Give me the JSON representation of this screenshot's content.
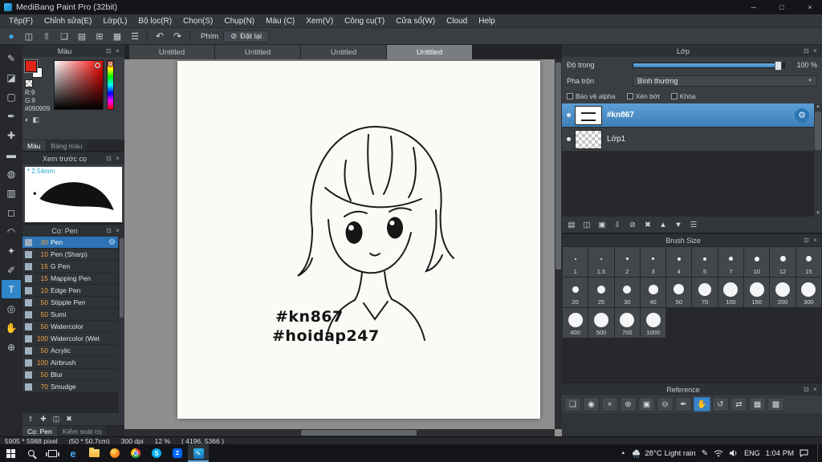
{
  "ui": {
    "popout_glyph": "⊡",
    "close_glyph": "×",
    "min_glyph": "─",
    "max_glyph": "□",
    "undo_glyph": "↶",
    "redo_glyph": "↷",
    "gear_glyph": "⚙",
    "dropdown_glyph": "▼",
    "scroll_up_glyph": "▲",
    "scroll_down_glyph": "▼"
  },
  "window": {
    "title": "MediBang Paint Pro (32bit)"
  },
  "menu_bar": {
    "items": [
      "Tệp(F)",
      "Chỉnh sửa(E)",
      "Lớp(L)",
      "Bộ lọc(R)",
      "Chọn(S)",
      "Chụp(N)",
      "Màu (C)",
      "Xem(V)",
      "Công cụ(T)",
      "Cửa sổ(W)",
      "Cloud",
      "Help"
    ]
  },
  "toolbar": {
    "icons": [
      {
        "name": "cloud-icon",
        "glyph": "●"
      },
      {
        "name": "save-icon",
        "glyph": "◫"
      },
      {
        "name": "export-icon",
        "glyph": "⇧"
      },
      {
        "name": "window-icon",
        "glyph": "❏"
      },
      {
        "name": "document-icon",
        "glyph": "▤"
      },
      {
        "name": "grid-icon",
        "glyph": "⊞"
      },
      {
        "name": "material-panel-icon",
        "glyph": "▦"
      },
      {
        "name": "list-icon",
        "glyph": "☰"
      }
    ],
    "key_label": "Phím",
    "reset_icon_glyph": "⊘",
    "reset_button": "Đặt lại"
  },
  "tools": [
    {
      "name": "brush-tool",
      "glyph": "✎"
    },
    {
      "name": "eraser-tool",
      "glyph": "◪"
    },
    {
      "name": "marquee-tool",
      "glyph": "▢"
    },
    {
      "name": "pen-tool",
      "glyph": "✒"
    },
    {
      "name": "move-tool",
      "glyph": "✚"
    },
    {
      "name": "shape-brush-tool",
      "glyph": "▬"
    },
    {
      "name": "bucket-tool",
      "glyph": "◍"
    },
    {
      "name": "gradient-tool",
      "glyph": "▥"
    },
    {
      "name": "select-tool",
      "glyph": "◻"
    },
    {
      "name": "lasso-tool",
      "glyph": "◠"
    },
    {
      "name": "magic-wand-tool",
      "glyph": "✦"
    },
    {
      "name": "select-pen-tool",
      "glyph": "✐"
    },
    {
      "name": "text-tool",
      "glyph": "T",
      "active": true
    },
    {
      "name": "eyedropper-tool",
      "glyph": "◎"
    },
    {
      "name": "pan-tool",
      "glyph": "✋"
    },
    {
      "name": "zoom-tool",
      "glyph": "⊕"
    }
  ],
  "color_panel": {
    "title": "Màu",
    "r_value": "R:9",
    "g_value": "G:9",
    "hex_value": "#090909",
    "tabs": [
      {
        "label": "Màu",
        "active": true
      },
      {
        "label": "Bảng màu",
        "active": false
      }
    ]
  },
  "preview_panel": {
    "title": "Xem trước cọ",
    "size_label": "* 2.54mm"
  },
  "brush_panel": {
    "title": "Cọ: Pen",
    "brushes": [
      {
        "size": "30",
        "name": "Pen",
        "selected": true
      },
      {
        "size": "10",
        "name": "Pen (Sharp)"
      },
      {
        "size": "15",
        "name": "G Pen"
      },
      {
        "size": "15",
        "name": "Mapping Pen"
      },
      {
        "size": "10",
        "name": "Edge Pen"
      },
      {
        "size": "50",
        "name": "Stipple Pen"
      },
      {
        "size": "50",
        "name": "Sumi"
      },
      {
        "size": "50",
        "name": "Watercolor"
      },
      {
        "size": "100",
        "name": "Watercolor (Wet"
      },
      {
        "size": "50",
        "name": "Acrylic"
      },
      {
        "size": "100",
        "name": "Airbrush"
      },
      {
        "size": "50",
        "name": "Blur"
      },
      {
        "size": "70",
        "name": "Smudge"
      }
    ],
    "footer_icons": [
      {
        "name": "upload-brush-icon",
        "glyph": "⇧"
      },
      {
        "name": "add-brush-icon",
        "glyph": "✚"
      },
      {
        "name": "duplicate-brush-icon",
        "glyph": "◫"
      },
      {
        "name": "delete-brush-icon",
        "glyph": "✖"
      }
    ],
    "tabs": [
      {
        "label": "Cọ: Pen",
        "active": true
      },
      {
        "label": "Kiểm soát cọ",
        "active": false
      }
    ]
  },
  "canvas": {
    "tabs": [
      {
        "label": "Untitled",
        "active": false
      },
      {
        "label": "Untitled",
        "active": false
      },
      {
        "label": "Untitled",
        "active": false
      },
      {
        "label": "Untitled",
        "active": true
      }
    ],
    "hashtag_line1": "#kn867",
    "hashtag_line2": "#hoidap247"
  },
  "layer_panel": {
    "title": "Lớp",
    "opacity_label": "Độ trong",
    "opacity_value": "100 %",
    "blend_label": "Pha trộn",
    "blend_value": "Bình thường",
    "options": [
      "Bảo vệ alpha",
      "Xén bớt",
      "Khóa"
    ],
    "layers": [
      {
        "name": "#kn867",
        "selected": true,
        "thumb": "thumb-art"
      },
      {
        "name": "Lớp1",
        "selected": false,
        "thumb": "thumb-checker"
      }
    ],
    "footer_icons": [
      {
        "name": "new-layer-icon",
        "glyph": "▤"
      },
      {
        "name": "duplicate-layer-icon",
        "glyph": "◫"
      },
      {
        "name": "new-folder-icon",
        "glyph": "▣"
      },
      {
        "name": "merge-layer-icon",
        "glyph": "⇩"
      },
      {
        "name": "clear-layer-icon",
        "glyph": "⊘"
      },
      {
        "name": "delete-layer-icon",
        "glyph": "✖"
      },
      {
        "name": "move-layer-up-icon",
        "glyph": "▲"
      },
      {
        "name": "move-layer-down-icon",
        "glyph": "▼"
      },
      {
        "name": "layer-menu-icon",
        "glyph": "☰"
      }
    ]
  },
  "brush_size_panel": {
    "title": "Brush Size",
    "sizes": [
      "1",
      "1.5",
      "2",
      "3",
      "4",
      "5",
      "7",
      "10",
      "12",
      "15",
      "20",
      "25",
      "30",
      "40",
      "50",
      "70",
      "100",
      "150",
      "200",
      "300",
      "400",
      "500",
      "700",
      "1000"
    ]
  },
  "reference_panel": {
    "title": "Reference",
    "icons": [
      {
        "name": "open-reference-icon",
        "glyph": "❏"
      },
      {
        "name": "capture-icon",
        "glyph": "◉"
      },
      {
        "name": "close-reference-icon",
        "glyph": "×"
      },
      {
        "name": "zoom-in-icon",
        "glyph": "⊕"
      },
      {
        "name": "fit-view-icon",
        "glyph": "▣"
      },
      {
        "name": "zoom-out-icon",
        "glyph": "⊖"
      },
      {
        "name": "eyedropper-icon",
        "glyph": "✒"
      },
      {
        "name": "hand-icon",
        "glyph": "✋",
        "active": true
      },
      {
        "name": "rotate-icon",
        "glyph": "↺"
      },
      {
        "name": "flip-icon",
        "glyph": "⇄"
      },
      {
        "name": "grid-overlay-icon",
        "glyph": "▦"
      },
      {
        "name": "image-icon",
        "glyph": "▩"
      }
    ]
  },
  "status_bar": {
    "segments": [
      "5905 * 5988 pixel",
      "(50 * 50.7cm)",
      "300 dpi",
      "12 %",
      "( 4196, 5366 )"
    ]
  },
  "taskbar": {
    "apps": [
      {
        "icon": "edge-icon",
        "glyph": "e",
        "active": false
      },
      {
        "icon": "file-explorer-icon",
        "glyph": "",
        "active": false
      },
      {
        "icon": "firefox-icon",
        "glyph": "",
        "active": false
      },
      {
        "icon": "chrome-icon",
        "glyph": "",
        "active": false
      },
      {
        "icon": "skype-icon",
        "glyph": "S",
        "active": false
      },
      {
        "icon": "zalo-icon",
        "glyph": "Z",
        "active": false
      },
      {
        "icon": "medibang-icon",
        "glyph": "✎",
        "active": true
      }
    ],
    "weather_temp": "28°C",
    "weather_desc": "Light rain",
    "language": "ENG",
    "time": "1:04 PM"
  }
}
